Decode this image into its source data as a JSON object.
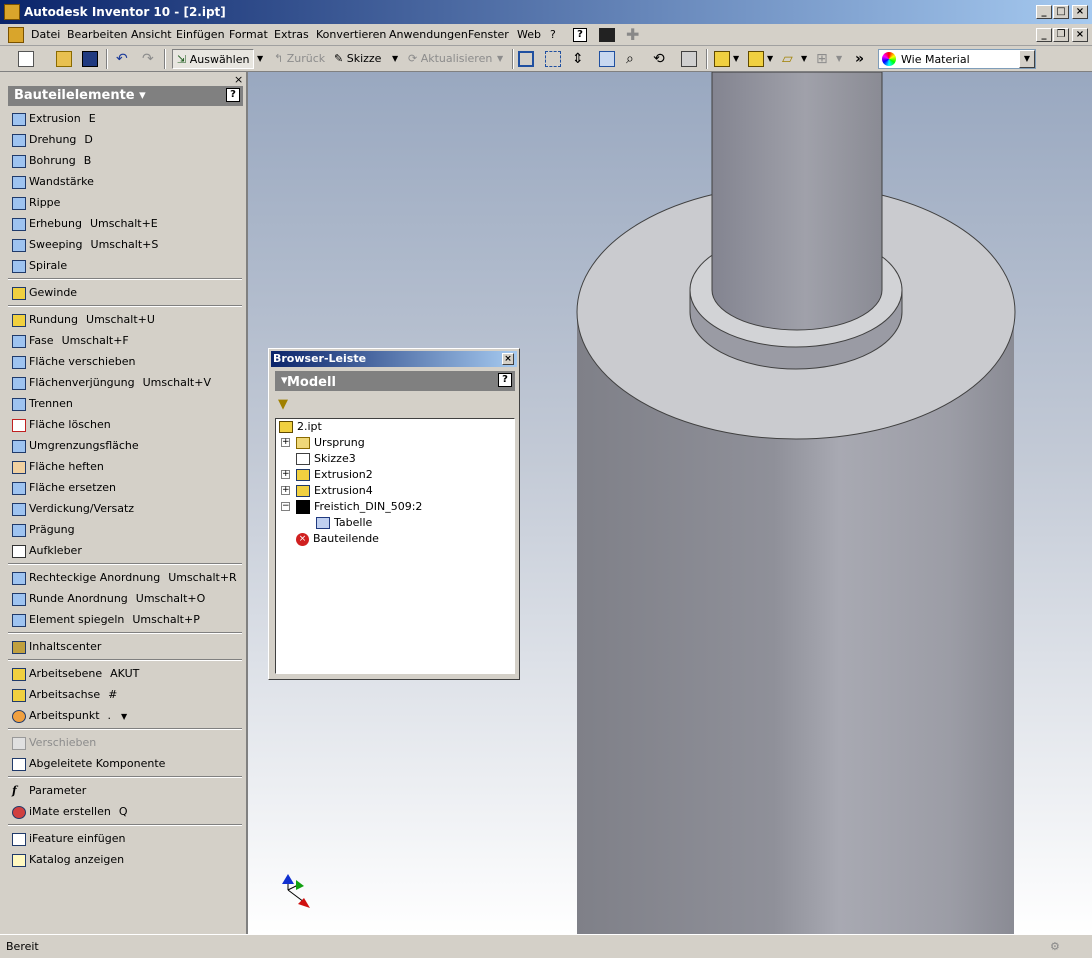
{
  "window": {
    "title": "Autodesk Inventor 10 - [2.ipt]"
  },
  "menu": [
    "Datei",
    "Bearbeiten",
    "Ansicht",
    "Einfügen",
    "Format",
    "Extras",
    "Konvertieren",
    "Anwendungen",
    "Fenster",
    "Web",
    "?"
  ],
  "toolbar": {
    "select_label": "Auswählen",
    "back_label": "Zurück",
    "sketch_label": "Skizze",
    "update_label": "Aktualisieren",
    "material": "Wie Material"
  },
  "panel": {
    "title": "Bauteilelemente",
    "items": [
      {
        "label": "Extrusion",
        "shortcut": "E"
      },
      {
        "label": "Drehung",
        "shortcut": "D"
      },
      {
        "label": "Bohrung",
        "shortcut": "B"
      },
      {
        "label": "Wandstärke",
        "shortcut": ""
      },
      {
        "label": "Rippe",
        "shortcut": ""
      },
      {
        "label": "Erhebung",
        "shortcut": "Umschalt+E"
      },
      {
        "label": "Sweeping",
        "shortcut": "Umschalt+S"
      },
      {
        "label": "Spirale",
        "shortcut": ""
      },
      {
        "label": "Gewinde",
        "shortcut": ""
      },
      {
        "label": "Rundung",
        "shortcut": "Umschalt+U"
      },
      {
        "label": "Fase",
        "shortcut": "Umschalt+F"
      },
      {
        "label": "Fläche verschieben",
        "shortcut": ""
      },
      {
        "label": "Flächenverjüngung",
        "shortcut": "Umschalt+V"
      },
      {
        "label": "Trennen",
        "shortcut": ""
      },
      {
        "label": "Fläche löschen",
        "shortcut": ""
      },
      {
        "label": "Umgrenzungsfläche",
        "shortcut": ""
      },
      {
        "label": "Fläche heften",
        "shortcut": ""
      },
      {
        "label": "Fläche ersetzen",
        "shortcut": ""
      },
      {
        "label": "Verdickung/Versatz",
        "shortcut": ""
      },
      {
        "label": "Prägung",
        "shortcut": ""
      },
      {
        "label": "Aufkleber",
        "shortcut": ""
      },
      {
        "label": "Rechteckige Anordnung",
        "shortcut": "Umschalt+R"
      },
      {
        "label": "Runde Anordnung",
        "shortcut": "Umschalt+O"
      },
      {
        "label": "Element spiegeln",
        "shortcut": "Umschalt+P"
      },
      {
        "label": "Inhaltscenter",
        "shortcut": ""
      },
      {
        "label": "Arbeitsebene",
        "shortcut": "AKUT"
      },
      {
        "label": "Arbeitsachse",
        "shortcut": "#"
      },
      {
        "label": "Arbeitspunkt",
        "shortcut": "."
      },
      {
        "label": "Verschieben",
        "shortcut": ""
      },
      {
        "label": "Abgeleitete Komponente",
        "shortcut": ""
      },
      {
        "label": "Parameter",
        "shortcut": ""
      },
      {
        "label": "iMate erstellen",
        "shortcut": "Q"
      },
      {
        "label": "iFeature einfügen",
        "shortcut": ""
      },
      {
        "label": "Katalog anzeigen",
        "shortcut": ""
      }
    ]
  },
  "browser": {
    "title": "Browser-Leiste",
    "mode": "Modell",
    "tree": [
      {
        "label": "2.ipt"
      },
      {
        "label": "Ursprung"
      },
      {
        "label": "Skizze3"
      },
      {
        "label": "Extrusion2"
      },
      {
        "label": "Extrusion4"
      },
      {
        "label": "Freistich_DIN_509:2"
      },
      {
        "label": "Tabelle"
      },
      {
        "label": "Bauteilende"
      }
    ]
  },
  "status": {
    "text": "Bereit"
  },
  "colors": {
    "title_start": "#0a246a",
    "title_end": "#a6caf0",
    "chrome": "#d4d0c8",
    "part": "#8f9099"
  }
}
